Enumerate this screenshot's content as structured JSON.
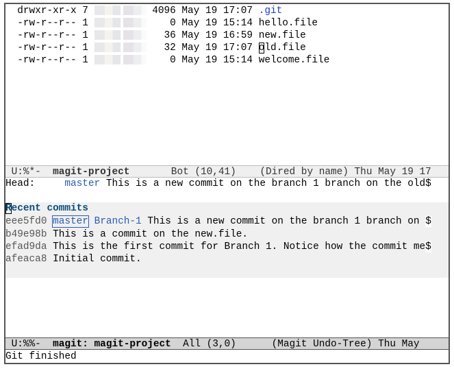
{
  "dired": {
    "rows": [
      {
        "perms": "drwxr-xr-x",
        "links": "7",
        "size": "4096",
        "month": "May",
        "day": "19",
        "time": "17:07",
        "name": ".git",
        "is_dir": true
      },
      {
        "perms": "-rw-r--r--",
        "links": "1",
        "size": "0",
        "month": "May",
        "day": "19",
        "time": "15:14",
        "name": "hello.file",
        "is_dir": false
      },
      {
        "perms": "-rw-r--r--",
        "links": "1",
        "size": "36",
        "month": "May",
        "day": "19",
        "time": "16:59",
        "name": "new.file",
        "is_dir": false
      },
      {
        "perms": "-rw-r--r--",
        "links": "1",
        "size": "32",
        "month": "May",
        "day": "19",
        "time": "17:07",
        "name": "old.file",
        "is_dir": false,
        "cursor": true
      },
      {
        "perms": "-rw-r--r--",
        "links": "1",
        "size": "0",
        "month": "May",
        "day": "19",
        "time": "15:14",
        "name": "welcome.file",
        "is_dir": false
      }
    ]
  },
  "modeline_top": {
    "status": " U:%*-  ",
    "buffer": "magit-project",
    "position": "       Bot (10,41)    ",
    "mode": "(Dired by name)",
    "clock": " Thu May 19 17"
  },
  "magit": {
    "head_label": "Head:     ",
    "head_branch": "master",
    "head_message": " This is a new commit on the branch 1 branch on the old",
    "truncation": "$",
    "section_title_first": "R",
    "section_title_rest": "ecent commits",
    "commits": [
      {
        "hash": "eee5fd0",
        "refs": [
          "master",
          "Branch-1"
        ],
        "message": " This is a new commit on the branch 1 branch on ",
        "truncated": true
      },
      {
        "hash": "b49e98b",
        "refs": [],
        "message": " This is a commit on the new.file.",
        "truncated": false
      },
      {
        "hash": "efad9da",
        "refs": [],
        "message": " This is the first commit for Branch 1. Notice how the commit me",
        "truncated": true
      },
      {
        "hash": "afeaca8",
        "refs": [],
        "message": " Initial commit.",
        "truncated": false
      }
    ]
  },
  "modeline_bottom": {
    "status": " U:%%-  ",
    "buffer": "magit: magit-project",
    "position": "  All (3,0)      ",
    "mode": "(Magit Undo-Tree)",
    "clock": " Thu May"
  },
  "echo_area": {
    "message": "Git finished"
  }
}
